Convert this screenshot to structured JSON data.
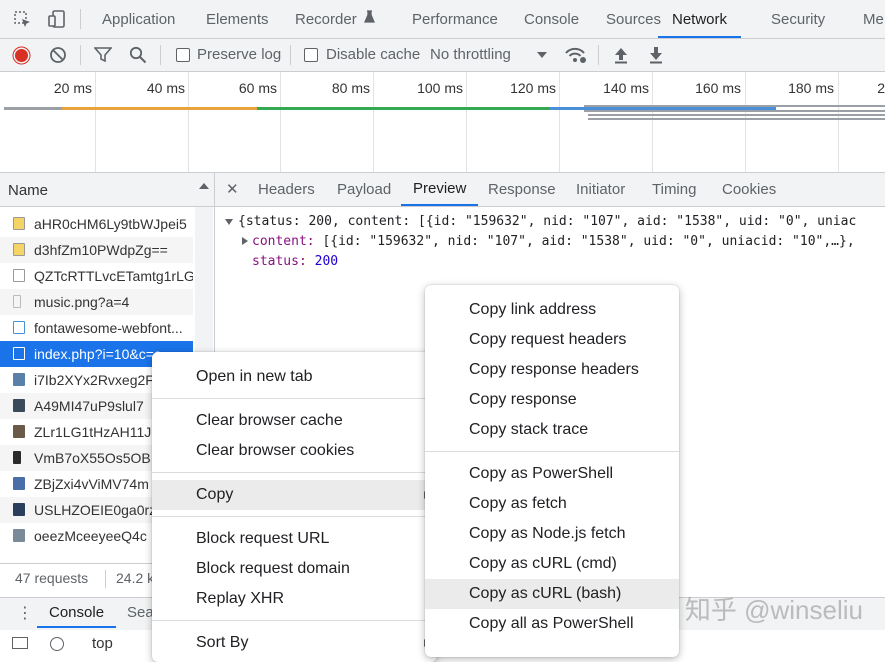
{
  "top_tabs": [
    "Application",
    "Elements",
    "Recorder",
    "Performance",
    "Console",
    "Sources",
    "Network",
    "Security",
    "Me"
  ],
  "toolbar": {
    "preserve_log": "Preserve log",
    "disable_cache": "Disable cache",
    "throttling": "No throttling"
  },
  "timeline_ticks": [
    "20 ms",
    "40 ms",
    "60 ms",
    "80 ms",
    "100 ms",
    "120 ms",
    "140 ms",
    "160 ms",
    "180 ms",
    "2"
  ],
  "name_header": "Name",
  "requests": [
    "aHR0cHM6Ly9tbWJpei5",
    "d3hfZm10PWdpZg==",
    "QZTcRTTLvcETamtg1rLG.",
    "music.png?a=4",
    "fontawesome-webfont...",
    "index.php?i=10&c=e",
    "i7Ib2XYx2Rvxeg2F",
    "A49MI47uP9slul7",
    "ZLr1LG1tHzAH11J",
    "VmB7oX55Os5OB",
    "ZBjZxi4vViMV74m",
    "USLHZOEIE0ga0rz",
    "oeezMceeyeeQ4c"
  ],
  "status": {
    "requests": "47 requests",
    "transferred": "24.2 k"
  },
  "drawer_tabs": [
    "Console",
    "Sea"
  ],
  "bottom_toolbar": {
    "context": "top"
  },
  "detail_tabs": [
    "Headers",
    "Payload",
    "Preview",
    "Response",
    "Initiator",
    "Timing",
    "Cookies"
  ],
  "preview": {
    "line1": "{status: 200, content: [{id: \"159632\", nid: \"107\", aid: \"1538\", uid: \"0\", uniac",
    "content_key": "content:",
    "content_val": " [{id: \"159632\", nid: \"107\", aid: \"1538\", uid: \"0\", uniacid: \"10\",…},",
    "status_key": "status:",
    "status_val": "200"
  },
  "context_menu": {
    "items": [
      "Open in new tab",
      "Clear browser cache",
      "Clear browser cookies",
      "Copy",
      "Block request URL",
      "Block request domain",
      "Replay XHR",
      "Sort By"
    ]
  },
  "copy_submenu": {
    "items": [
      "Copy link address",
      "Copy request headers",
      "Copy response headers",
      "Copy response",
      "Copy stack trace",
      "Copy as PowerShell",
      "Copy as fetch",
      "Copy as Node.js fetch",
      "Copy as cURL (cmd)",
      "Copy as cURL (bash)",
      "Copy all as PowerShell"
    ],
    "highlighted": "Copy as cURL (bash)"
  },
  "watermark": "知乎 @winseliu",
  "colors": {
    "accent": "#1a73e8",
    "record": "#d93025"
  }
}
